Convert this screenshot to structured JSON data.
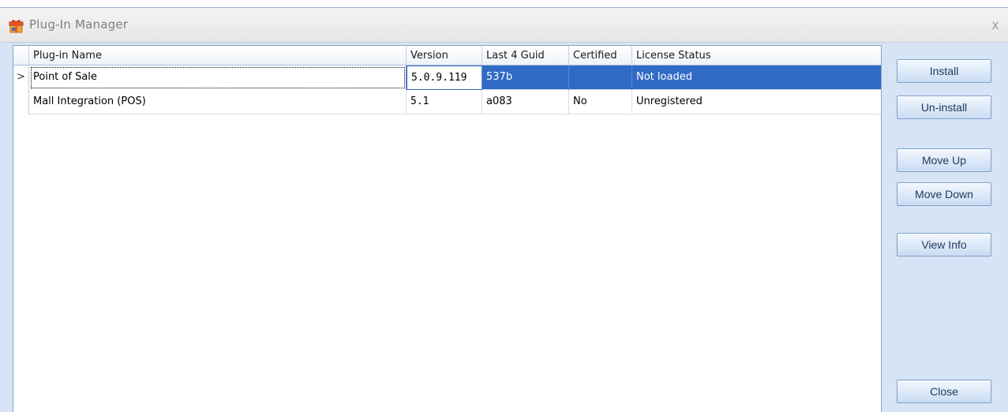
{
  "window": {
    "title": "Plug-In Manager",
    "close_glyph": "x",
    "icon": "plugin-gift-icon"
  },
  "grid": {
    "columns": [
      "Plug-in Name",
      "Version",
      "Last 4 Guid",
      "Certified",
      "License Status"
    ],
    "rows": [
      {
        "selected": true,
        "indicator": ">",
        "name": "Point of Sale",
        "version": "5.0.9.119",
        "guid": "537b",
        "certified": "",
        "license": "Not loaded"
      },
      {
        "selected": false,
        "indicator": "",
        "name": "Mall Integration (POS)",
        "version": "5.1",
        "guid": "a083",
        "certified": "No",
        "license": "Unregistered"
      }
    ]
  },
  "buttons": {
    "install": "Install",
    "uninstall": "Un-install",
    "move_up": "Move Up",
    "move_down": "Move Down",
    "view_info": "View Info",
    "close": "Close"
  },
  "colors": {
    "selection": "#316ac5",
    "panel": "#d6e4f5",
    "button_text": "#1e395b"
  }
}
